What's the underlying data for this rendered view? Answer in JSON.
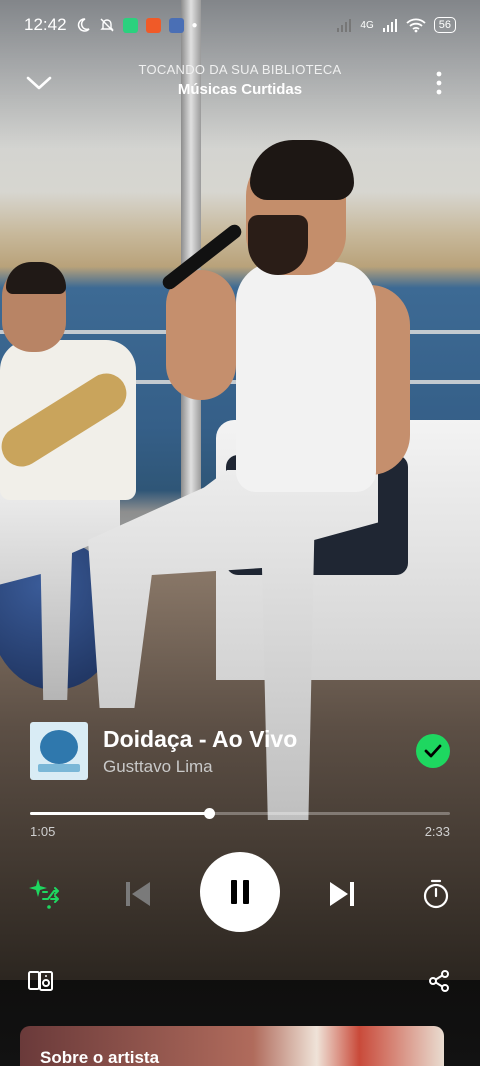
{
  "status_bar": {
    "time": "12:42",
    "network": "4G",
    "battery": "56"
  },
  "header": {
    "context_kicker": "TOCANDO DA SUA BIBLIOTECA",
    "context_title": "Músicas Curtidas"
  },
  "track": {
    "title": "Doidaça - Ao Vivo",
    "artist": "Gusttavo Lima",
    "liked": true
  },
  "playback": {
    "elapsed": "1:05",
    "total": "2:33",
    "progress_fraction": 0.425,
    "is_playing": true
  },
  "about": {
    "title": "Sobre o artista"
  },
  "colors": {
    "accent": "#1ed760",
    "background": "#121212"
  },
  "icons": {
    "collapse": "chevron-down-icon",
    "more": "more-vertical-icon",
    "smart_shuffle": "smart-shuffle-icon",
    "previous": "skip-previous-icon",
    "pause": "pause-icon",
    "next": "skip-next-icon",
    "sleep_timer": "timer-icon",
    "devices": "devices-icon",
    "share": "share-icon",
    "liked": "check-icon"
  }
}
